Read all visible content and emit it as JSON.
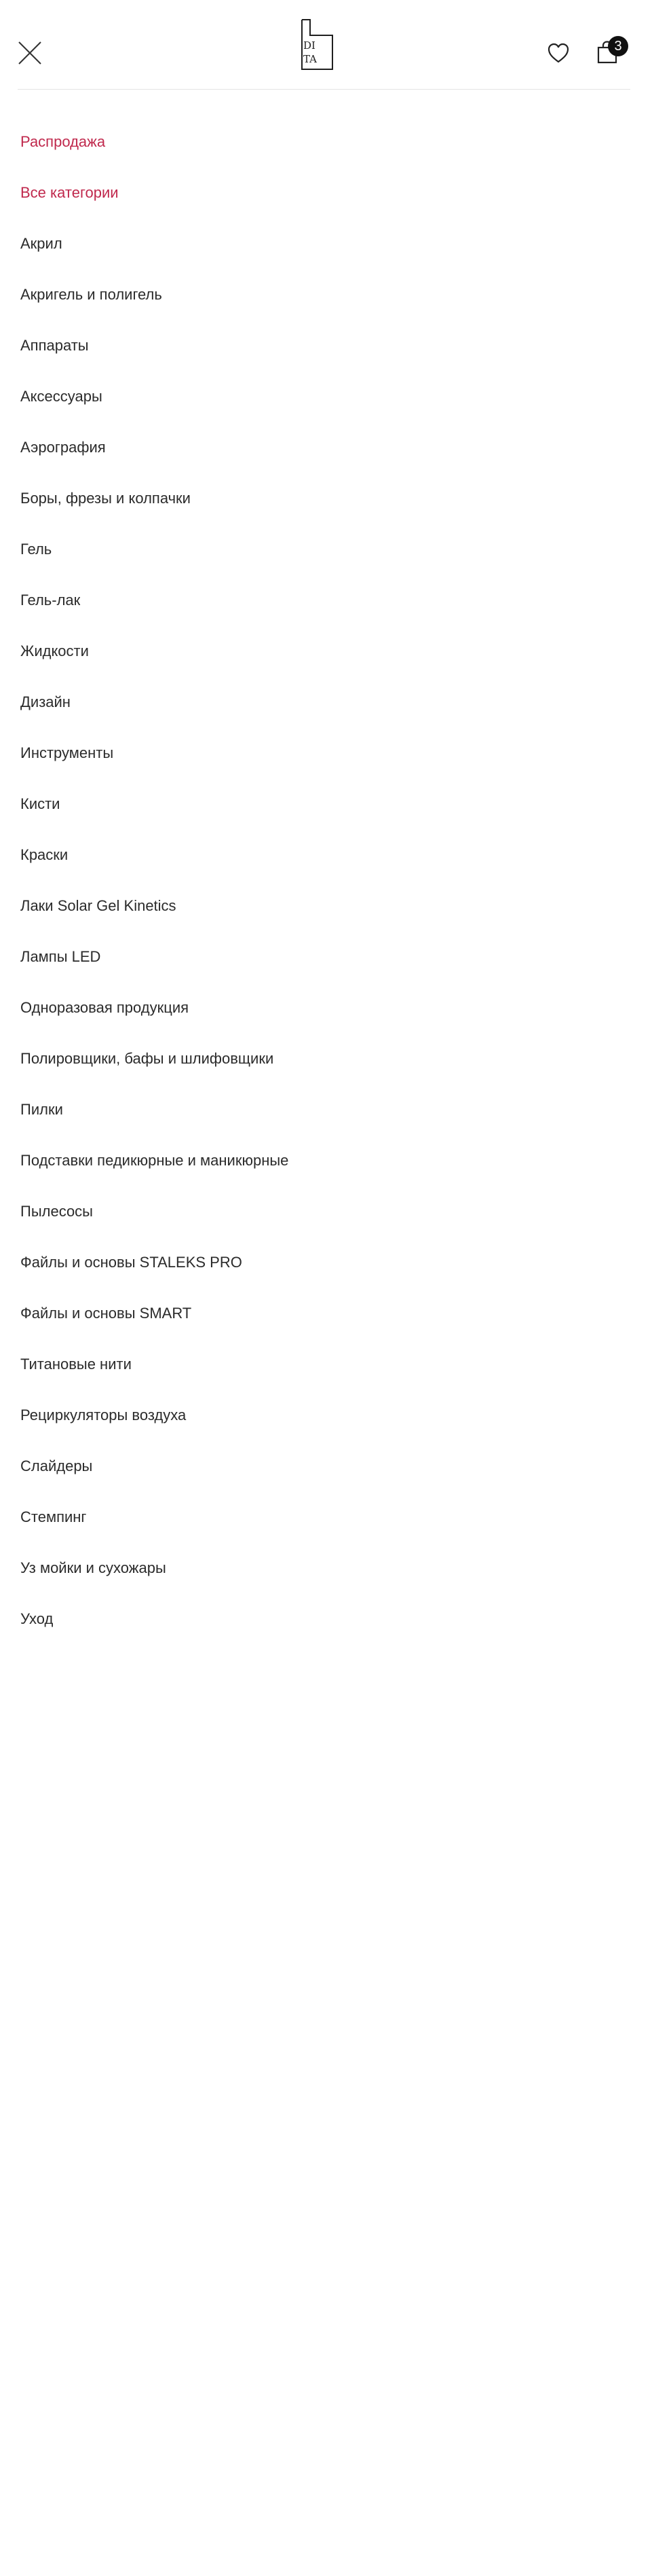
{
  "header": {
    "logo_line1": "DI",
    "logo_line2": "TA",
    "cart_count": "3",
    "close_icon": "close-icon",
    "favorites_icon": "heart-icon",
    "cart_icon": "shopping-bag-icon"
  },
  "colors": {
    "accent": "#c0294d",
    "text": "#2b2b2b",
    "badge": "#111111"
  },
  "menu": {
    "items": [
      {
        "label": "Распродажа",
        "accent": true
      },
      {
        "label": "Все категории",
        "accent": true
      },
      {
        "label": "Акрил"
      },
      {
        "label": "Акригель и полигель"
      },
      {
        "label": "Аппараты"
      },
      {
        "label": "Аксессуары"
      },
      {
        "label": "Аэрография"
      },
      {
        "label": "Боры, фрезы и колпачки"
      },
      {
        "label": "Гель"
      },
      {
        "label": "Гель-лак"
      },
      {
        "label": "Жидкости"
      },
      {
        "label": "Дизайн"
      },
      {
        "label": "Инструменты"
      },
      {
        "label": "Кисти"
      },
      {
        "label": "Краски"
      },
      {
        "label": "Лаки Solar Gel Kinetics"
      },
      {
        "label": "Лампы LED"
      },
      {
        "label": "Одноразовая продукция"
      },
      {
        "label": "Полировщики, бафы и шлифовщики"
      },
      {
        "label": "Пилки"
      },
      {
        "label": "Подставки педикюрные и маникюрные"
      },
      {
        "label": "Пылесосы"
      },
      {
        "label": "Файлы и основы STALEKS PRO"
      },
      {
        "label": "Файлы и основы SMART"
      },
      {
        "label": "Титановые нити"
      },
      {
        "label": "Рециркуляторы воздуха"
      },
      {
        "label": "Слайдеры"
      },
      {
        "label": "Стемпинг"
      },
      {
        "label": "Уз мойки и сухожары"
      },
      {
        "label": "Уход"
      }
    ]
  }
}
